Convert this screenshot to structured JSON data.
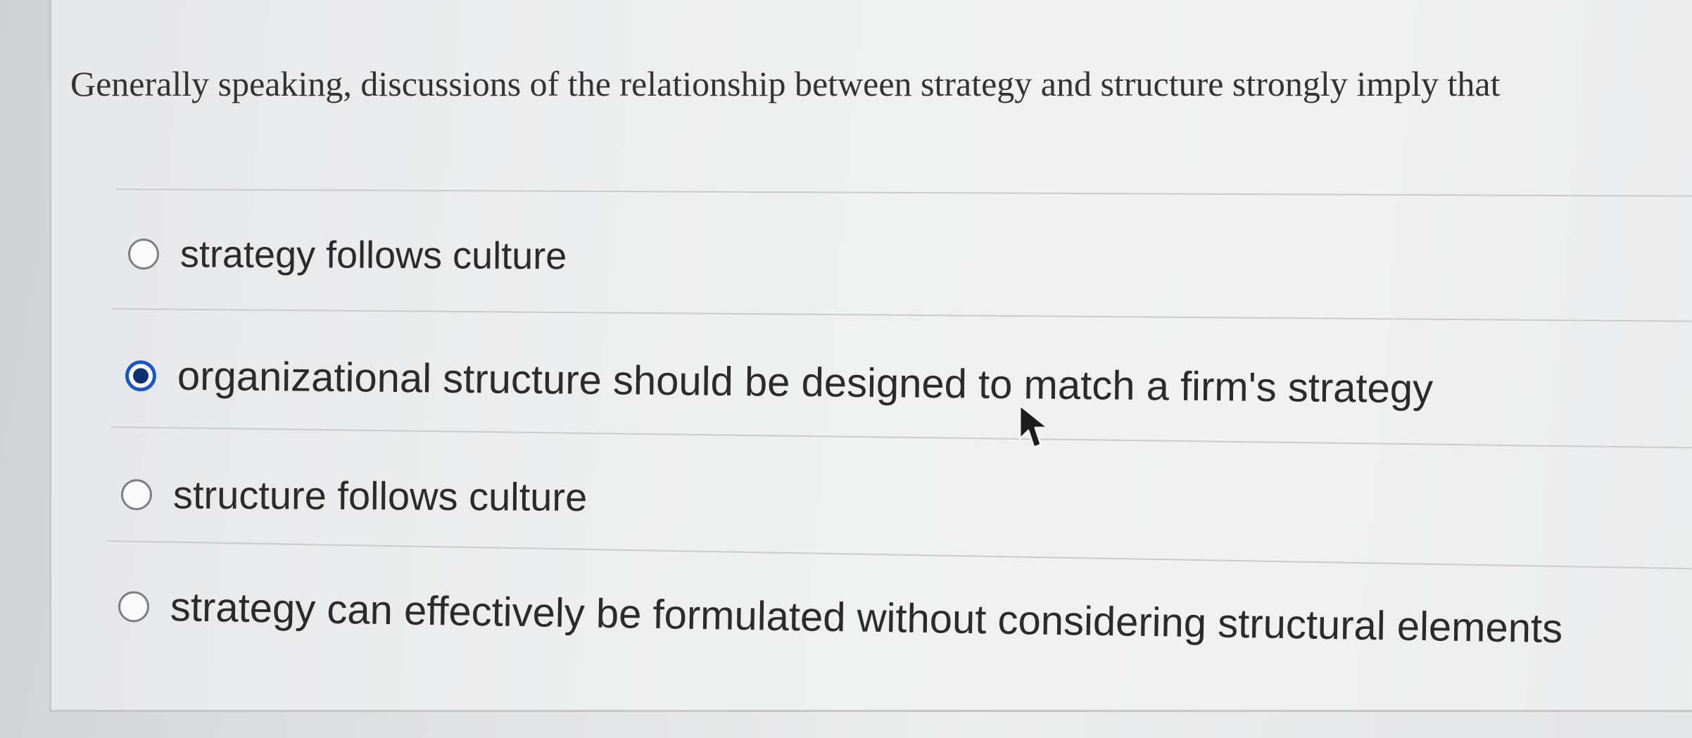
{
  "question": {
    "text": "Generally speaking, discussions of the relationship between strategy and structure strongly imply that"
  },
  "options": [
    {
      "label": "strategy follows culture",
      "selected": false
    },
    {
      "label": "organizational structure should be designed to match a firm's strategy",
      "selected": true
    },
    {
      "label": "structure follows culture",
      "selected": false
    },
    {
      "label": "strategy can effectively be formulated without considering structural elements",
      "selected": false
    }
  ],
  "colors": {
    "selected_radio_ring": "#1a56c4",
    "selected_radio_dot": "#0f2f73",
    "text": "#2b2b2b"
  },
  "icons": {
    "cursor": "mouse-pointer-icon"
  }
}
